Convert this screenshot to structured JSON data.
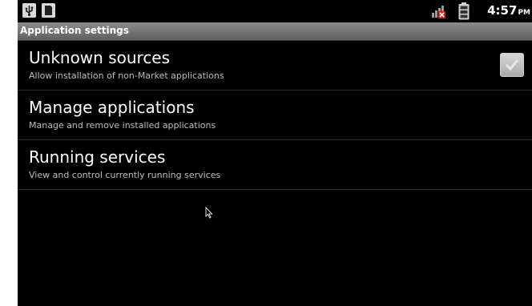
{
  "status_bar": {
    "left_icons": [
      "usb-icon",
      "sd-card-icon"
    ],
    "right_icons": [
      "no-signal-icon",
      "battery-icon"
    ],
    "time": "4:57",
    "ampm": "PM"
  },
  "title_bar": {
    "title": "Application settings"
  },
  "settings": [
    {
      "label": "Unknown sources",
      "summary": "Allow installation of non-Market applications",
      "checked": true
    },
    {
      "label": "Manage applications",
      "summary": "Manage and remove installed applications"
    },
    {
      "label": "Running services",
      "summary": "View and control currently running services"
    }
  ],
  "colors": {
    "background": "#000000",
    "title_bar": "#7a7a7a",
    "primary_text": "#ffffff",
    "secondary_text": "#bdbdbd"
  }
}
